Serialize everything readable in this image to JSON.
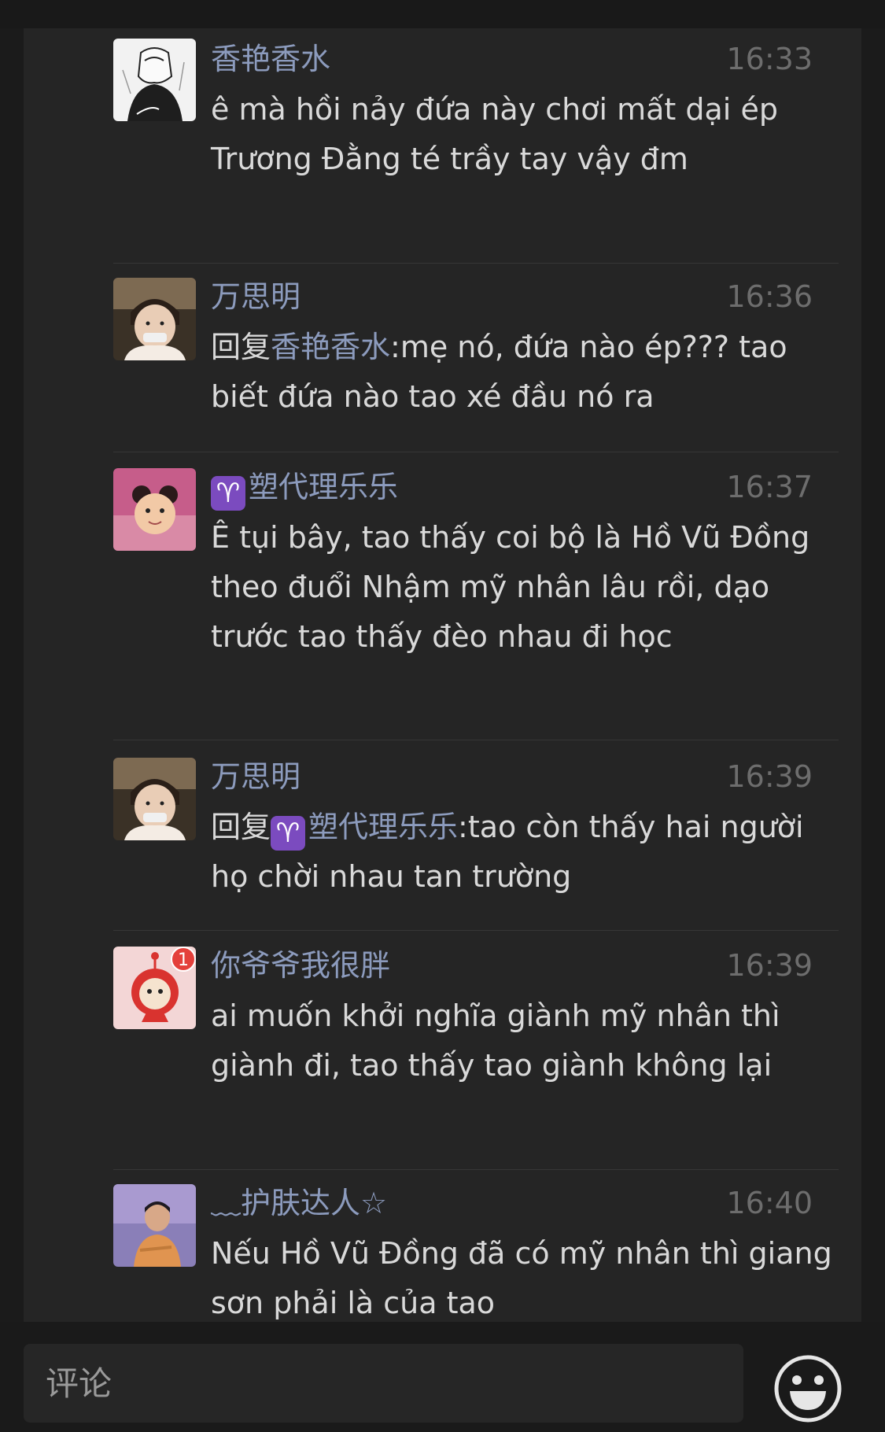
{
  "comments": [
    {
      "name": "香艳香水",
      "time": "16:33",
      "text": "ê mà hồi nảy đứa này chơi mất dại ép Trương Đằng té trầy tay vậy đm"
    },
    {
      "name": "万思明",
      "time": "16:36",
      "reply_prefix": "回复",
      "reply_to": "香艳香水",
      "text": ":mẹ nó, đứa nào ép??? tao biết đứa nào tao xé đầu nó ra"
    },
    {
      "name_icon": "♈",
      "name": "塑代理乐乐",
      "time": "16:37",
      "text": "Ê tụi bây, tao thấy coi bộ là Hồ Vũ Đồng theo đuổi Nhậm mỹ nhân lâu rồi, dạo trước tao thấy đèo nhau đi học"
    },
    {
      "name": "万思明",
      "time": "16:39",
      "reply_prefix": "回复",
      "reply_icon": "♈",
      "reply_to": "塑代理乐乐",
      "text": ":tao còn thấy hai người họ chời nhau tan trường"
    },
    {
      "name": "你爷爷我很胖",
      "badge": "1",
      "time": "16:39",
      "text": "ai muốn khởi nghĩa giành mỹ nhân thì giành đi, tao thấy tao giành không lại"
    },
    {
      "name": "﹏护肤达人☆",
      "time": "16:40",
      "text": "Nếu Hồ Vũ Đồng đã có mỹ nhân thì giang sơn phải là của tao"
    }
  ],
  "input": {
    "placeholder": "评论"
  },
  "icons": {
    "emoji": "smiley-face-icon"
  },
  "colors": {
    "background": "#252525",
    "name": "#8c9bbd",
    "text": "#d9d9d9",
    "time": "#6d6d6d"
  }
}
